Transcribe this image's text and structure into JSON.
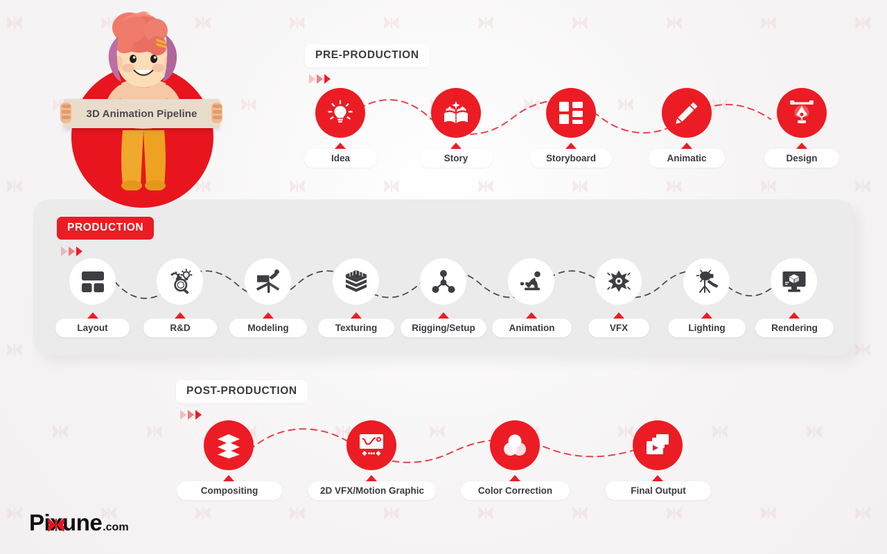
{
  "meta": {
    "hero_sign_text": "3D Animation Pipeline",
    "brand_name": "Pixune",
    "brand_domain": ".com"
  },
  "colors": {
    "brand_red": "#ec1c24",
    "hero_red": "#e8151f",
    "dark": "#3a3a40",
    "card_bg": "#ebebeb",
    "page_bg": "#f7f5f5",
    "sign_bg": "#e9dccb"
  },
  "sections": [
    {
      "id": "pre-production",
      "title": "PRE-PRODUCTION",
      "title_style": "light",
      "circle_style": "red",
      "connector_color": "#e8404a",
      "steps": [
        {
          "label": "Idea",
          "icon": "lightbulb-icon"
        },
        {
          "label": "Story",
          "icon": "open-book-sparkle-icon"
        },
        {
          "label": "Storyboard",
          "icon": "storyboard-grid-icon"
        },
        {
          "label": "Animatic",
          "icon": "pencil-icon"
        },
        {
          "label": "Design",
          "icon": "pen-tool-icon"
        }
      ]
    },
    {
      "id": "production",
      "title": "PRODUCTION",
      "title_style": "solid",
      "circle_style": "white",
      "connector_color": "#4a4a52",
      "steps": [
        {
          "label": "Layout",
          "icon": "layout-grid-icon"
        },
        {
          "label": "R&D",
          "icon": "gear-magnifier-bulb-icon"
        },
        {
          "label": "Modeling",
          "icon": "modeling-sculpt-icon"
        },
        {
          "label": "Texturing",
          "icon": "layered-cube-icon"
        },
        {
          "label": "Rigging/Setup",
          "icon": "node-skeleton-icon"
        },
        {
          "label": "Animation",
          "icon": "running-figure-icon"
        },
        {
          "label": "VFX",
          "icon": "starburst-gear-icon"
        },
        {
          "label": "Lighting",
          "icon": "studio-light-icon"
        },
        {
          "label": "Rendering",
          "icon": "monitor-cube-icon"
        }
      ]
    },
    {
      "id": "post-production",
      "title": "POST-PRODUCTION",
      "title_style": "light",
      "circle_style": "red",
      "connector_color": "#e8404a",
      "steps": [
        {
          "label": "Compositing",
          "icon": "stacked-layers-icon"
        },
        {
          "label": "2D VFX/Motion Graphic",
          "icon": "motion-curve-icon"
        },
        {
          "label": "Color Correction",
          "icon": "color-circles-icon"
        },
        {
          "label": "Final Output",
          "icon": "video-frames-play-icon"
        }
      ]
    }
  ]
}
